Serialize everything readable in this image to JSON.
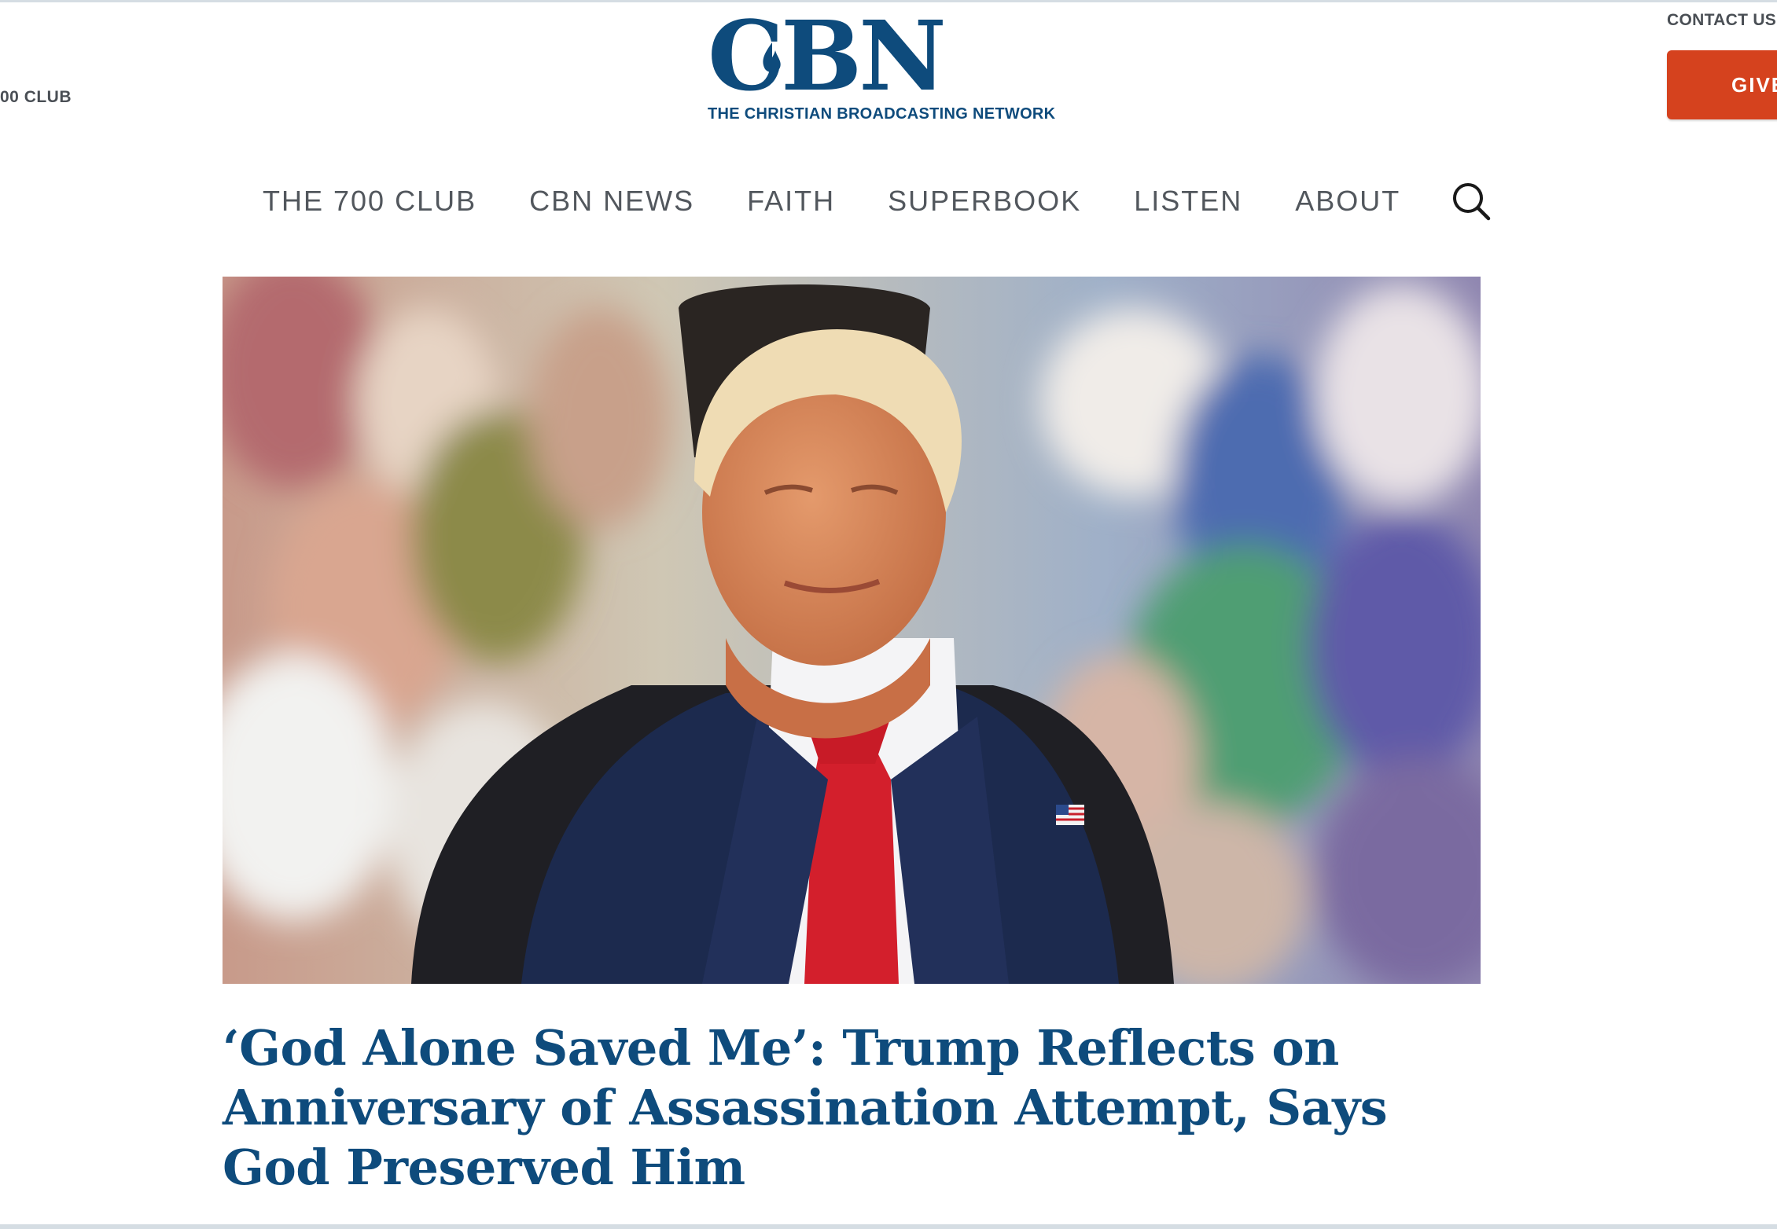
{
  "header": {
    "top_left_link": "00 CLUB",
    "contact_label": "CONTACT US",
    "give_label": "GIVE",
    "logo": {
      "text": "CBN",
      "tagline": "THE CHRISTIAN BROADCASTING NETWORK",
      "color": "#0e4b7c"
    }
  },
  "nav": {
    "items": [
      "THE 700 CLUB",
      "CBN NEWS",
      "FAITH",
      "SUPERBOOK",
      "LISTEN",
      "ABOUT"
    ],
    "search_icon": "search-icon"
  },
  "article": {
    "headline": "‘God Alone Saved Me’: Trump Reflects on Anniversary of Assassination Attempt, Says God Preserved Him",
    "headline_color": "#0e4b7c"
  },
  "colors": {
    "brand": "#0e4b7c",
    "give_button": "#d5421e",
    "nav_text": "#52575d"
  }
}
